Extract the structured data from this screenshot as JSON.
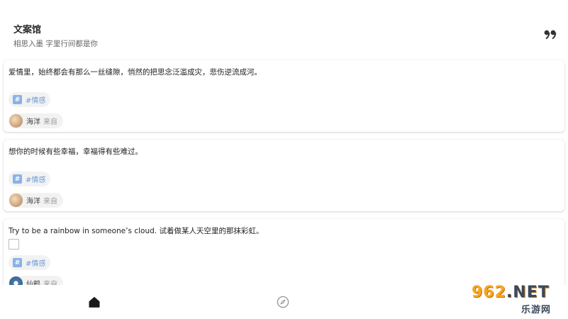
{
  "header": {
    "title": "文案馆",
    "subtitle": "相思入墨 字里行间都是你",
    "quote_icon": "quote-icon"
  },
  "cards": [
    {
      "text": "爱情里，始终都会有那么一丝缝隙，悄然的把思念泛滥成灾，悲伤逆流成河。",
      "tag": "#情感",
      "author": "海洋",
      "from_label": "来自"
    },
    {
      "text": "想你的时候有些幸福，幸福得有些难过。",
      "tag": "#情感",
      "author": "海洋",
      "from_label": "来自"
    },
    {
      "text": "Try to be a rainbow in someone’s cloud. 试着做某人天空里的那抹彩虹。",
      "tag": "#情感",
      "author": "仙鹤",
      "from_label": "来自"
    }
  ],
  "bottom_nav": {
    "items": [
      {
        "icon": "home-icon",
        "active": true
      },
      {
        "icon": "compass-icon",
        "active": false
      }
    ]
  },
  "watermark": {
    "brand": "962",
    "domain": ".NET",
    "subtitle": "乐游网"
  },
  "colors": {
    "tag_accent": "#8ab2e6",
    "tag_text": "#6e9bd8",
    "background": "#ffffff"
  }
}
